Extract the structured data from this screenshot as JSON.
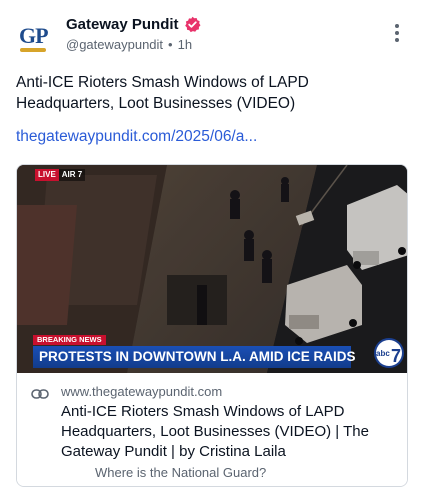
{
  "author": {
    "name": "Gateway Pundit",
    "handle": "@gatewaypundit",
    "separator": "•",
    "time": "1h",
    "avatar_text": "GP",
    "verified_color": "#e8336b"
  },
  "post": {
    "text": "Anti-ICE Rioters Smash Windows of LAPD Headquarters, Loot Businesses (VIDEO)",
    "link": "thegatewaypundit.com/2025/06/a..."
  },
  "card": {
    "image": {
      "live_label": "LIVE",
      "air_label": "AIR 7",
      "breaking_label": "BREAKING NEWS",
      "chyron": "PROTESTS IN DOWNTOWN L.A. AMID ICE RAIDS",
      "channel_logo": "abc 7"
    },
    "domain": "www.thegatewaypundit.com",
    "title": "Anti-ICE Rioters Smash Windows of LAPD Headquarters, Loot Businesses (VIDEO) | The Gateway Pundit | by Cristina Laila",
    "description": "Where is the National Guard?"
  },
  "icons": {
    "more": "more-vertical-icon",
    "link": "link-icon",
    "verified": "verified-badge-icon"
  },
  "colors": {
    "link": "#2a5bd7",
    "muted": "#5b6470",
    "chyron": "#1a4fb5",
    "breaking": "#c8102e"
  }
}
